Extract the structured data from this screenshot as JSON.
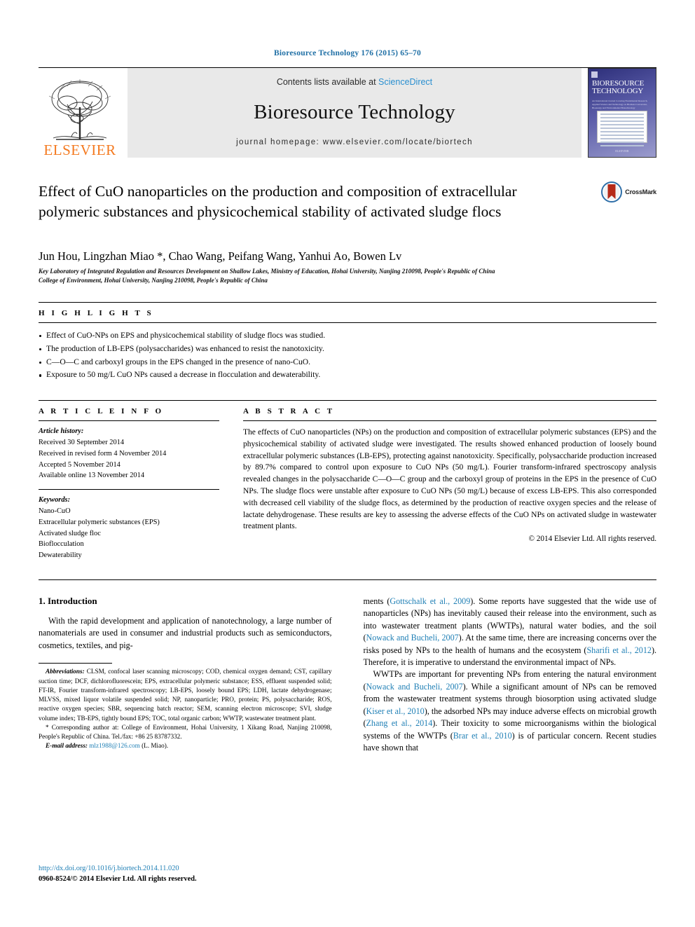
{
  "running_head": "Bioresource Technology 176 (2015) 65–70",
  "masthead": {
    "publisher": "ELSEVIER",
    "contents_prefix": "Contents lists available at",
    "contents_link": "ScienceDirect",
    "journal_title": "Bioresource Technology",
    "homepage": "journal homepage: www.elsevier.com/locate/biortech",
    "cover": {
      "line1": "BIORESOURCE",
      "line2": "TECHNOLOGY",
      "blurb": "An International Journal Covering Fundamental Research, Applied Science and Technology on Biomass Conversion, Bioenergy and Environmental Biotechnology",
      "footer": "ELSEVIER"
    }
  },
  "article": {
    "title": "Effect of CuO nanoparticles on the production and composition of extracellular polymeric substances and physicochemical stability of activated sludge flocs",
    "crossmark_label": "CrossMark",
    "authors": "Jun Hou, Lingzhan Miao *, Chao Wang, Peifang Wang, Yanhui Ao, Bowen Lv",
    "affiliations": [
      "Key Laboratory of Integrated Regulation and Resources Development on Shallow Lakes, Ministry of Education, Hohai University, Nanjing 210098, People's Republic of China",
      "College of Environment, Hohai University, Nanjing 210098, People's Republic of China"
    ]
  },
  "highlights": {
    "heading": "H I G H L I G H T S",
    "items": [
      "Effect of CuO-NPs on EPS and physicochemical stability of sludge flocs was studied.",
      "The production of LB-EPS (polysaccharides) was enhanced to resist the nanotoxicity.",
      "C—O—C and carboxyl groups in the EPS changed in the presence of nano-CuO.",
      "Exposure to 50 mg/L CuO NPs caused a decrease in flocculation and dewaterability."
    ]
  },
  "article_info": {
    "heading": "A R T I C L E    I N F O",
    "history_label": "Article history:",
    "history": [
      "Received 30 September 2014",
      "Received in revised form 4 November 2014",
      "Accepted 5 November 2014",
      "Available online 13 November 2014"
    ],
    "keywords_label": "Keywords:",
    "keywords": [
      "Nano-CuO",
      "Extracellular polymeric substances (EPS)",
      "Activated sludge floc",
      "Bioflocculation",
      "Dewaterability"
    ]
  },
  "abstract": {
    "heading": "A B S T R A C T",
    "text": "The effects of CuO nanoparticles (NPs) on the production and composition of extracellular polymeric substances (EPS) and the physicochemical stability of activated sludge were investigated. The results showed enhanced production of loosely bound extracellular polymeric substances (LB-EPS), protecting against nanotoxicity. Specifically, polysaccharide production increased by 89.7% compared to control upon exposure to CuO NPs (50 mg/L). Fourier transform-infrared spectroscopy analysis revealed changes in the polysaccharide C—O—C group and the carboxyl group of proteins in the EPS in the presence of CuO NPs. The sludge flocs were unstable after exposure to CuO NPs (50 mg/L) because of excess LB-EPS. This also corresponded with decreased cell viability of the sludge flocs, as determined by the production of reactive oxygen species and the release of lactate dehydrogenase. These results are key to assessing the adverse effects of the CuO NPs on activated sludge in wastewater treatment plants.",
    "copyright": "© 2014 Elsevier Ltd. All rights reserved."
  },
  "body": {
    "section_title": "1. Introduction",
    "left_paragraph": "With the rapid development and application of nanotechnology, a large number of nanomaterials are used in consumer and industrial products such as semiconductors, cosmetics, textiles, and pig-",
    "right_paragraph_1_pre": "ments (",
    "right_paragraph_1_ref1": "Gottschalk et al., 2009",
    "right_paragraph_1_mid": "). Some reports have suggested that the wide use of nanoparticles (NPs) has inevitably caused their release into the environment, such as into wastewater treatment plants (WWTPs), natural water bodies, and the soil (",
    "right_paragraph_1_ref2": "Nowack and Bucheli, 2007",
    "right_paragraph_1_mid2": "). At the same time, there are increasing concerns over the risks posed by NPs to the health of humans and the ecosystem (",
    "right_paragraph_1_ref3": "Sharifi et al., 2012",
    "right_paragraph_1_end": "). Therefore, it is imperative to understand the environmental impact of NPs.",
    "right_paragraph_2_pre": "WWTPs are important for preventing NPs from entering the natural environment (",
    "right_paragraph_2_ref1": "Nowack and Bucheli, 2007",
    "right_paragraph_2_mid": "). While a significant amount of NPs can be removed from the wastewater treatment systems through biosorption using activated sludge (",
    "right_paragraph_2_ref2": "Kiser et al., 2010",
    "right_paragraph_2_mid2": "), the adsorbed NPs may induce adverse effects on microbial growth (",
    "right_paragraph_2_ref3": "Zhang et al., 2014",
    "right_paragraph_2_mid3": "). Their toxicity to some microorganisms within the biological systems of the WWTPs (",
    "right_paragraph_2_ref4": "Brar et al., 2010",
    "right_paragraph_2_end": ") is of particular concern. Recent studies have shown that"
  },
  "footnote": {
    "abbrev_label": "Abbreviations:",
    "abbrev_text": " CLSM, confocal laser scanning microscopy; COD, chemical oxygen demand; CST, capillary suction time; DCF, dichlorofluorescein; EPS, extracellular polymeric substance; ESS, effluent suspended solid; FT-IR, Fourier transform-infrared spectroscopy; LB-EPS, loosely bound EPS; LDH, lactate dehydrogenase; MLVSS, mixed liquor volatile suspended solid; NP, nanoparticle; PRO, protein; PS, polysaccharide; ROS, reactive oxygen species; SBR, sequencing batch reactor; SEM, scanning electron microscope; SVI, sludge volume index; TB-EPS, tightly bound EPS; TOC, total organic carbon; WWTP, wastewater treatment plant.",
    "corresponding": "* Corresponding author at: College of Environment, Hohai University, 1 Xikang Road, Nanjing 210098, People's Republic of China. Tel./fax: +86 25 83787332.",
    "email_label": "E-mail address:",
    "email": "mlz1988@126.com",
    "email_suffix": " (L. Miao)."
  },
  "page_footer": {
    "doi": "http://dx.doi.org/10.1016/j.biortech.2014.11.020",
    "issn_line": "0960-8524/© 2014 Elsevier Ltd. All rights reserved."
  }
}
